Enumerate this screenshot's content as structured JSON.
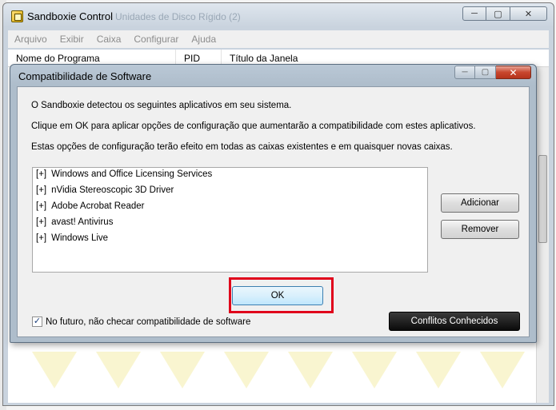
{
  "main_window": {
    "title": "Sandboxie Control",
    "ghost_title": "Unidades de Disco Rígido (2)",
    "controls": {
      "minimize": "─",
      "maximize": "▢",
      "close": "✕"
    },
    "menu": [
      "Arquivo",
      "Exibir",
      "Caixa",
      "Configurar",
      "Ajuda"
    ],
    "columns": [
      "Nome do Programa",
      "PID",
      "Título da Janela"
    ]
  },
  "dialog": {
    "title": "Compatibilidade de Software",
    "controls": {
      "minimize": "─",
      "maximize": "▢",
      "close": "✕"
    },
    "lines": [
      "O Sandboxie detectou os seguintes aplicativos em seu sistema.",
      "Clique em OK para aplicar opções de configuração que aumentarão a compatibilidade com estes aplicativos.",
      "Estas opções de configuração terão efeito em todas as caixas existentes e em quaisquer novas caixas."
    ],
    "software": [
      {
        "expander": "[+]",
        "name": "Windows and Office Licensing Services"
      },
      {
        "expander": "[+]",
        "name": "nVidia Stereoscopic 3D Driver"
      },
      {
        "expander": "[+]",
        "name": "Adobe Acrobat Reader"
      },
      {
        "expander": "[+]",
        "name": "avast! Antivirus"
      },
      {
        "expander": "[+]",
        "name": "Windows Live"
      }
    ],
    "buttons": {
      "add": "Adicionar",
      "remove": "Remover",
      "ok": "OK",
      "known_conflicts": "Conflitos Conhecidos"
    },
    "checkbox": {
      "label": "No futuro, não checar compatibilidade de software",
      "mark": "✓"
    }
  },
  "colors": {
    "highlight": "#e0001b",
    "dark_button": "#0b0b0b"
  }
}
